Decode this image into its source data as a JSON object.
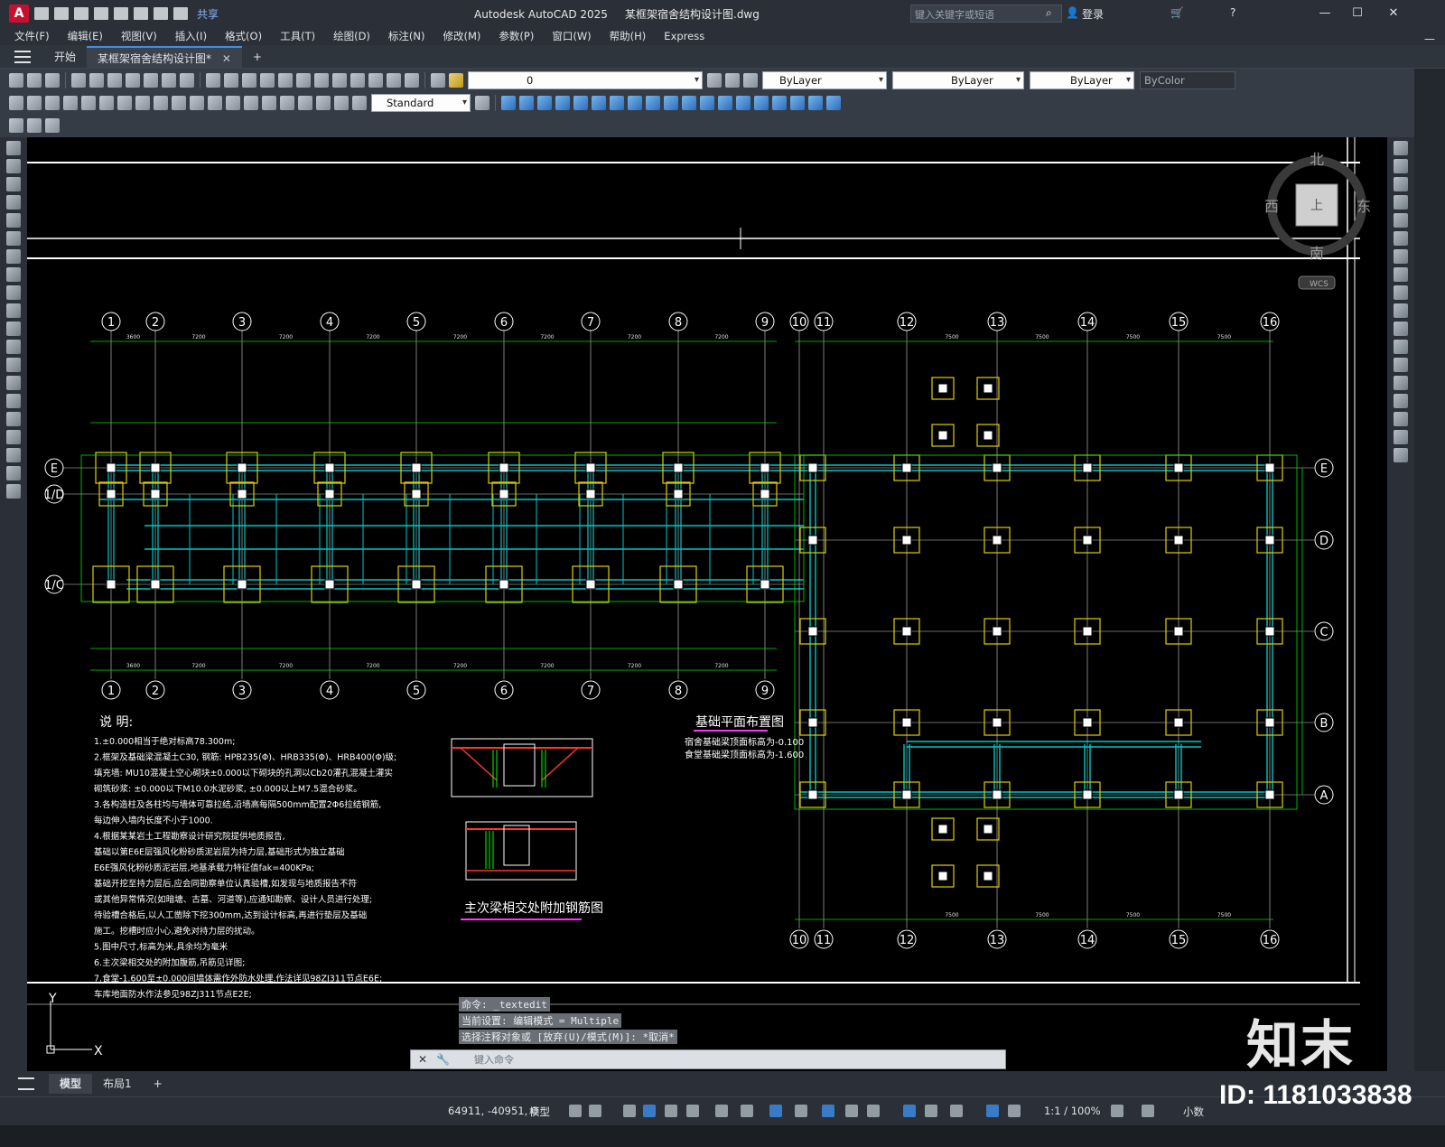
{
  "app": {
    "logo": "A",
    "title": "Autodesk AutoCAD 2025",
    "filename": "某框架宿舍结构设计图.dwg",
    "share": "共享",
    "search_placeholder": "键入关键字或短语",
    "login": "登录"
  },
  "menu": [
    "文件(F)",
    "编辑(E)",
    "视图(V)",
    "插入(I)",
    "格式(O)",
    "工具(T)",
    "绘图(D)",
    "标注(N)",
    "修改(M)",
    "参数(P)",
    "窗口(W)",
    "帮助(H)",
    "Express"
  ],
  "tabs": {
    "start": "开始",
    "drawing": "某框架宿舍结构设计图*",
    "add": "+"
  },
  "layer": {
    "current": "0"
  },
  "properties": {
    "color": "ByLayer",
    "linetype": "ByLayer",
    "lineweight": "ByLayer",
    "plotstyle": "ByColor"
  },
  "dimstyle": {
    "current": "Standard"
  },
  "viewcube": {
    "north": "北",
    "south": "南",
    "west": "西",
    "east": "东",
    "top": "上",
    "wcs": "WCS"
  },
  "drawing": {
    "grid_top_labels": [
      "1",
      "2",
      "3",
      "4",
      "5",
      "6",
      "7",
      "8",
      "9"
    ],
    "grid_right_top_labels": [
      "10",
      "11",
      "12",
      "13",
      "14",
      "15",
      "16"
    ],
    "grid_left_rows": [
      "E",
      "1/D",
      "1/C"
    ],
    "grid_right_rows": [
      "E",
      "D",
      "C",
      "B",
      "A"
    ],
    "dim_7200": "7200",
    "dim_3600": "3600",
    "dim_7500": "7500",
    "plan_title": "基础平面布置图",
    "plan_notes": [
      "宿舍基础梁顶面标高为-0.100",
      "食堂基础梁顶面标高为-1.600"
    ],
    "detail_title": "主次梁相交处附加钢筋图",
    "notes_title": "说 明:",
    "notes": [
      "1.±0.000相当于绝对标高78.300m;",
      "2.框架及基础梁混凝土C30, 钢筋: HPB235(Φ)、HRB335(Φ)、HRB400(Φ)级;",
      "  填充墙: MU10混凝土空心砌块±0.000以下砌块的孔洞以Cb20灌孔混凝土灌实",
      "  砌筑砂浆: ±0.000以下M10.0水泥砂浆, ±0.000以上M7.5混合砂浆。",
      "3.各构造柱及各柱均与墙体可靠拉结,沿墙高每隔500mm配置2Φ6拉结钢筋,",
      "  每边伸入墙内长度不小于1000.",
      "4.根据某某岩土工程勘察设计研究院提供地质报告,",
      "  基础以第E6E层强风化粉砂质泥岩层为持力层,基础形式为独立基础",
      "  E6E强风化粉砂质泥岩层,地基承载力特征值fak=400KPa;",
      "  基础开挖至持力层后,应会同勘察单位认真验槽,如发现与地质报告不符",
      "  或其他异常情况(如暗塘、古墓、河道等),应通知勘察、设计人员进行处理;",
      "  待验槽合格后,以人工凿除下挖300mm,达到设计标高,再进行垫层及基础",
      "  施工。挖槽时应小心,避免对持力层的扰动。",
      "5.图中尺寸,标高为米,具余均为毫米",
      "6.主次梁相交处的附加腹筋,吊筋见详图;",
      "7.食堂-1.600至±0.000间墙体需作外防水处理,作法详见98ZJ311节点E6E;",
      "  车库地面防水作法参见98ZJ311节点E2E;"
    ]
  },
  "command": {
    "history": [
      "命令: _textedit",
      "当前设置: 编辑模式 = Multiple",
      "选择注释对象或 [放弃(U)/模式(M)]: *取消*"
    ],
    "placeholder": "键入命令"
  },
  "layout_tabs": [
    "模型",
    "布局1"
  ],
  "status": {
    "coords": "64911, -40951, 0",
    "model": "模型",
    "scale": "1:1 / 100%",
    "units": "小数"
  },
  "watermark": {
    "logo": "知末",
    "id": "ID: 1181033838"
  },
  "ucs": {
    "x": "X",
    "y": "Y"
  }
}
